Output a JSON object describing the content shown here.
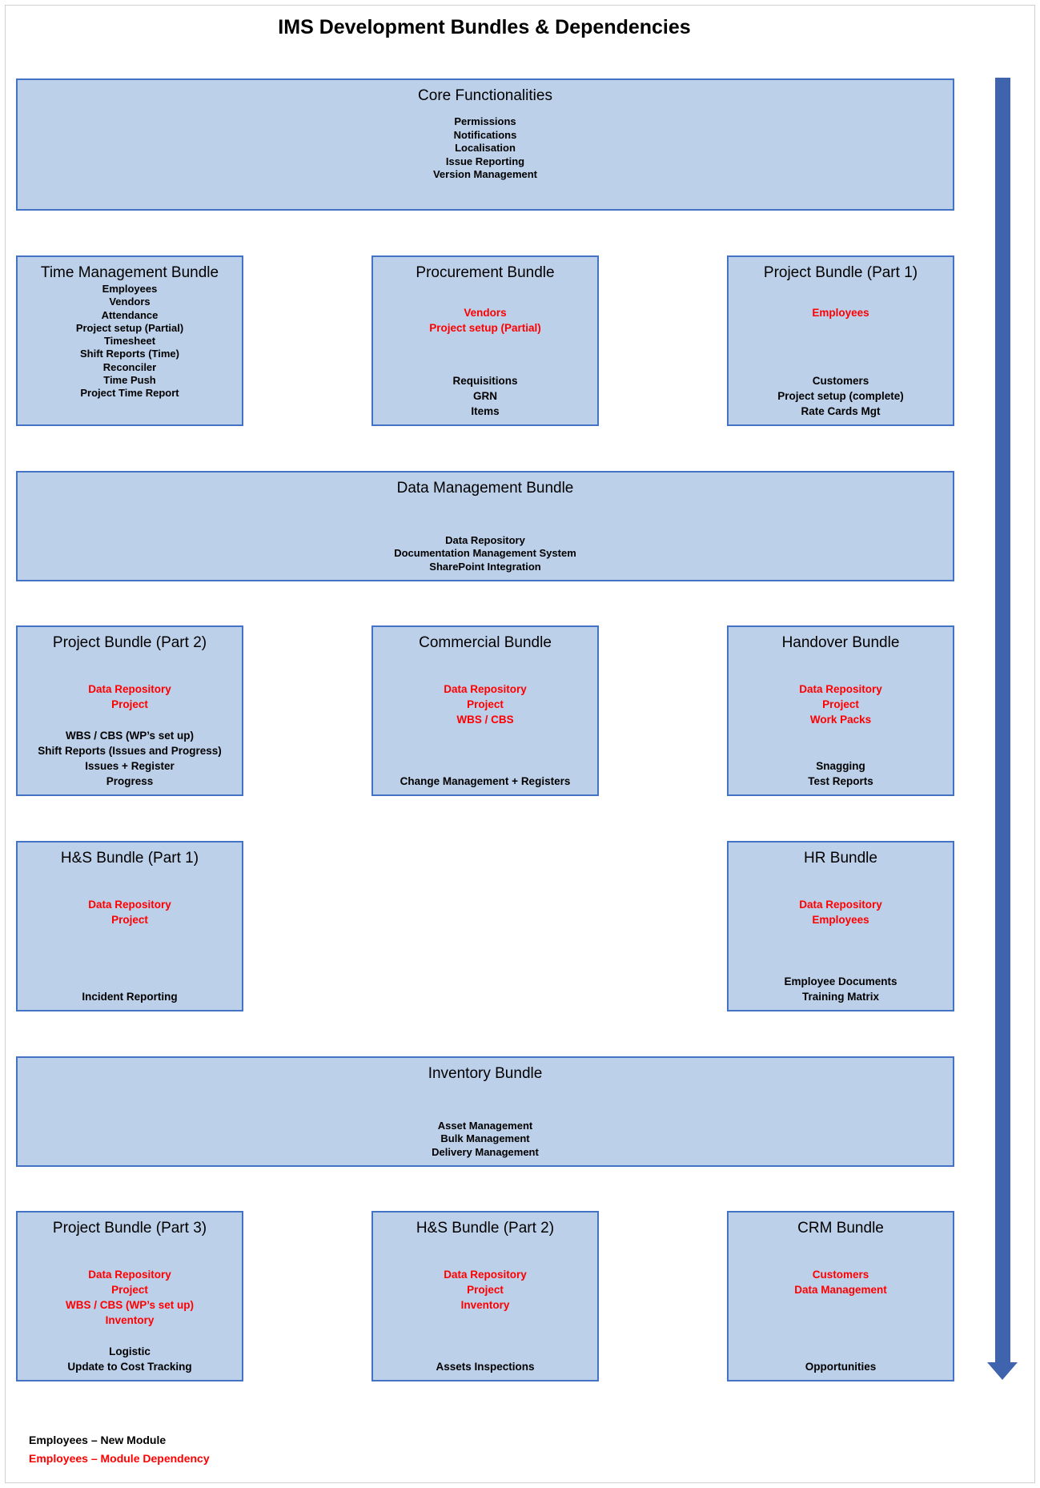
{
  "title": "IMS Development Bundles & Dependencies",
  "colors": {
    "box_fill": "#bdd0e9",
    "box_border": "#4472c4",
    "arrow": "#3f64ad",
    "dependency_text": "#ff0000",
    "new_module_text": "#000000"
  },
  "bundles": {
    "core": {
      "title": "Core Functionalities",
      "dependencies": [],
      "modules": [
        "Permissions",
        "Notifications",
        "Localisation",
        "Issue Reporting",
        "Version Management"
      ]
    },
    "time_management": {
      "title": "Time Management Bundle",
      "dependencies": [],
      "modules": [
        "Employees",
        "Vendors",
        "Attendance",
        "Project setup (Partial)",
        "Timesheet",
        "Shift Reports (Time)",
        "Reconciler",
        "Time Push",
        "Project Time Report"
      ]
    },
    "procurement": {
      "title": "Procurement Bundle",
      "dependencies": [
        "Vendors",
        "Project setup (Partial)"
      ],
      "modules": [
        "Requisitions",
        "GRN",
        "Items"
      ]
    },
    "project_part1": {
      "title": "Project Bundle (Part 1)",
      "dependencies": [
        "Employees"
      ],
      "modules": [
        "Customers",
        "Project setup (complete)",
        "Rate Cards Mgt"
      ]
    },
    "data_management": {
      "title": "Data Management Bundle",
      "dependencies": [],
      "modules": [
        "Data Repository",
        "Documentation Management System",
        "SharePoint Integration"
      ]
    },
    "project_part2": {
      "title": "Project Bundle (Part 2)",
      "dependencies": [
        "Data Repository",
        "Project"
      ],
      "modules": [
        "WBS / CBS (WP’s set up)",
        "Shift Reports (Issues and Progress)",
        "Issues + Register",
        "Progress"
      ]
    },
    "commercial": {
      "title": "Commercial Bundle",
      "dependencies": [
        "Data Repository",
        "Project",
        "WBS / CBS"
      ],
      "modules": [
        "Change Management + Registers"
      ]
    },
    "handover": {
      "title": "Handover Bundle",
      "dependencies": [
        "Data Repository",
        "Project",
        "Work Packs"
      ],
      "modules": [
        "Snagging",
        "Test Reports"
      ]
    },
    "hs_part1": {
      "title": "H&S Bundle (Part 1)",
      "dependencies": [
        "Data Repository",
        "Project"
      ],
      "modules": [
        "Incident Reporting"
      ]
    },
    "hr": {
      "title": "HR Bundle",
      "dependencies": [
        "Data Repository",
        "Employees"
      ],
      "modules": [
        "Employee Documents",
        "Training Matrix"
      ]
    },
    "inventory": {
      "title": "Inventory Bundle",
      "dependencies": [],
      "modules": [
        "Asset Management",
        "Bulk Management",
        "Delivery Management"
      ]
    },
    "project_part3": {
      "title": "Project Bundle (Part 3)",
      "dependencies": [
        "Data Repository",
        "Project",
        "WBS / CBS (WP’s set up)",
        "Inventory"
      ],
      "modules": [
        "Logistic",
        "Update to Cost Tracking"
      ]
    },
    "hs_part2": {
      "title": "H&S Bundle (Part 2)",
      "dependencies": [
        "Data Repository",
        "Project",
        "Inventory"
      ],
      "modules": [
        "Assets Inspections"
      ]
    },
    "crm": {
      "title": "CRM Bundle",
      "dependencies": [
        "Customers",
        "Data Management"
      ],
      "modules": [
        "Opportunities"
      ]
    }
  },
  "legend": {
    "new_module": "Employees – New Module",
    "module_dependency": "Employees – Module Dependency"
  },
  "flow_arrow": {
    "icon": "down-arrow-icon",
    "meaning": "development order top to bottom"
  }
}
